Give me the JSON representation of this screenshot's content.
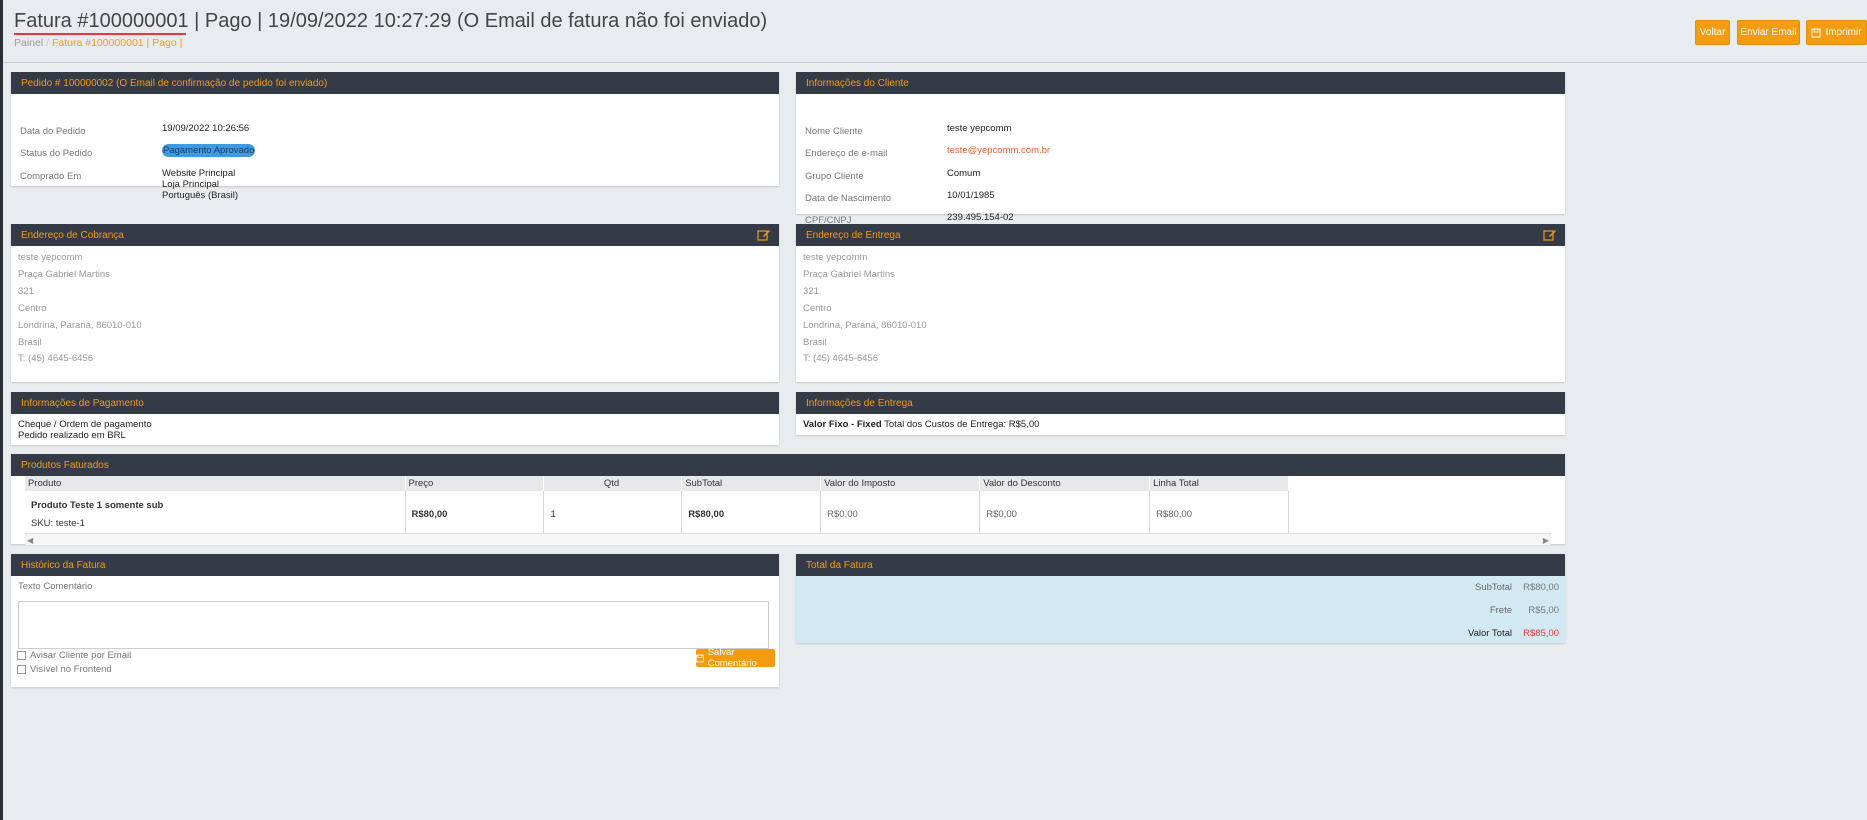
{
  "header": {
    "title": "Fatura #100000001 | Pago | 19/09/2022 10:27:29 (O Email de fatura não foi enviado)",
    "breadcrumb_home": "Painel",
    "breadcrumb_sep": "/",
    "breadcrumb_current": "Fatura #100000001 | Pago |",
    "buttons": {
      "back": "Voltar",
      "send_email": "Enviar Email",
      "print": "Imprimir"
    }
  },
  "order": {
    "heading_prefix": "Pedido # 100000002",
    "heading_note": "(O Email de confirmação de pedido foi enviado)",
    "date_label": "Data do Pedido",
    "date_value": "19/09/2022 10:26:56",
    "status_label": "Status do Pedido",
    "status_value": "Pagamento Aprovado",
    "purchased_label": "Comprado Em",
    "purchased_lines": [
      "Website Principal",
      "Loja Principal",
      "Português (Brasil)"
    ]
  },
  "customer": {
    "heading": "Informações do Cliente",
    "rows": [
      {
        "label": "Nome Cliente",
        "value": "teste yepcomm"
      },
      {
        "label": "Endereço de e-mail",
        "value": "teste@yepcomm.com.br"
      },
      {
        "label": "Grupo Cliente",
        "value": "Comum"
      },
      {
        "label": "Data de Nascimento",
        "value": "10/01/1985"
      },
      {
        "label": "CPF/CNPJ",
        "value": "239.495.154-02"
      }
    ]
  },
  "billing": {
    "heading": "Endereço de Cobrança",
    "lines": [
      "teste yepcomm",
      "Praça Gabriel Martins",
      "321",
      "Centro",
      "Londrina, Paraná, 86010-010",
      "Brasil",
      "T: (45) 4645-6456"
    ]
  },
  "shipping_address": {
    "heading": "Endereço de Entrega",
    "lines": [
      "teste yepcomm",
      "Praça Gabriel Martins",
      "321",
      "Centro",
      "Londrina, Paraná, 86010-010",
      "Brasil",
      "T: (45) 4645-6456"
    ]
  },
  "payment": {
    "heading": "Informações de Pagamento",
    "lines": [
      "Cheque / Ordem de pagamento",
      "Pedido realizado em BRL"
    ]
  },
  "delivery": {
    "heading": "Informações de Entrega",
    "method": "Valor Fixo - Fixed",
    "cost_text": "Total dos Custos de Entrega: R$5,00"
  },
  "products": {
    "heading": "Produtos Faturados",
    "columns": [
      "Produto",
      "Preço",
      "Qtd",
      "SubTotal",
      "Valor do Imposto",
      "Valor do Desconto",
      "Linha Total"
    ],
    "rows": [
      {
        "name": "Produto Teste 1 somente sub",
        "sku_label": "SKU:",
        "sku": "teste-1",
        "price": "R$80,00",
        "qty": "1",
        "subtotal": "R$80,00",
        "tax": "R$0,00",
        "discount": "R$0,00",
        "total": "R$80,00"
      }
    ]
  },
  "history": {
    "heading": "Histórico da Fatura",
    "comment_label": "Texto Comentário",
    "notify_label": "Avisar Cliente por Email",
    "visible_label": "Visível no Frontend",
    "save_label": "Salvar Comentário"
  },
  "totals": {
    "heading": "Total da Fatura",
    "subtotal_label": "SubTotal",
    "subtotal_value": "R$80,00",
    "shipping_label": "Frete",
    "shipping_value": "R$5,00",
    "grand_label": "Valor Total",
    "grand_value": "R$85,00"
  },
  "colors": {
    "accent": "#f39c12",
    "panel_header": "#343a46",
    "badge": "#3c9be0",
    "totals_bg": "#d2e8f3"
  }
}
